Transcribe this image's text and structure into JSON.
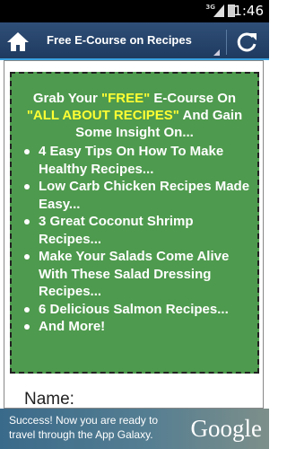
{
  "status_bar": {
    "network": "3G",
    "time": "1:46"
  },
  "action_bar": {
    "title": "Free E-Course on Recipes",
    "home_icon": "home-icon",
    "refresh_icon": "refresh-icon"
  },
  "promo": {
    "headline_1": "Grab Your ",
    "headline_free": "\"FREE\"",
    "headline_2": " E-Course On ",
    "headline_topic": "\"ALL ABOUT RECIPES\"",
    "headline_3": " And Gain Some Insight On...",
    "bullets": [
      "4 Easy Tips On How To Make Healthy Recipes...",
      "Low Carb Chicken Recipes Made Easy...",
      "3 Great Coconut Shrimp Recipes...",
      "Make Your Salads Come Alive With These Salad Dressing Recipes...",
      "6 Delicious Salmon Recipes...",
      "And More!"
    ],
    "background_color": "#4e9a4e",
    "highlight_color": "#ffff33"
  },
  "form": {
    "name_label": "Name:"
  },
  "ad": {
    "text": "Success! Now you are ready to travel through the App Galaxy.",
    "brand": "Google"
  }
}
